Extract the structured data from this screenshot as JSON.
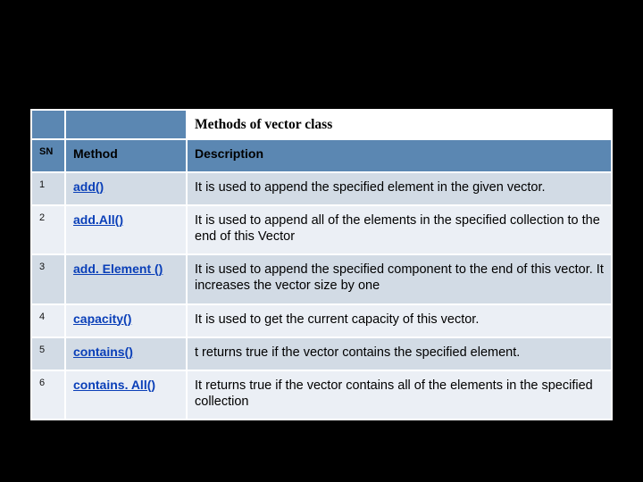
{
  "table": {
    "title": "Methods of vector class",
    "headers": {
      "sn": "SN",
      "method": "Method",
      "description": "Description"
    },
    "rows": [
      {
        "sn": "1",
        "method": "add()",
        "description": "It is used to append the specified element in the given vector."
      },
      {
        "sn": "2",
        "method": "add.All()",
        "description": "It is used to append all of the elements in the specified collection to the end of this Vector"
      },
      {
        "sn": "3",
        "method": "add. Element ()",
        "description": "It is used to append the specified component to the end of this vector. It increases the vector size by one"
      },
      {
        "sn": "4",
        "method": "capacity()",
        "description": "It is used to get the current capacity of this vector."
      },
      {
        "sn": "5",
        "method": "contains()",
        "description": "t returns true if the vector contains the specified element."
      },
      {
        "sn": "6",
        "method": "contains. All()",
        "description": "It returns true if the vector contains all of the elements in the specified collection"
      }
    ]
  }
}
